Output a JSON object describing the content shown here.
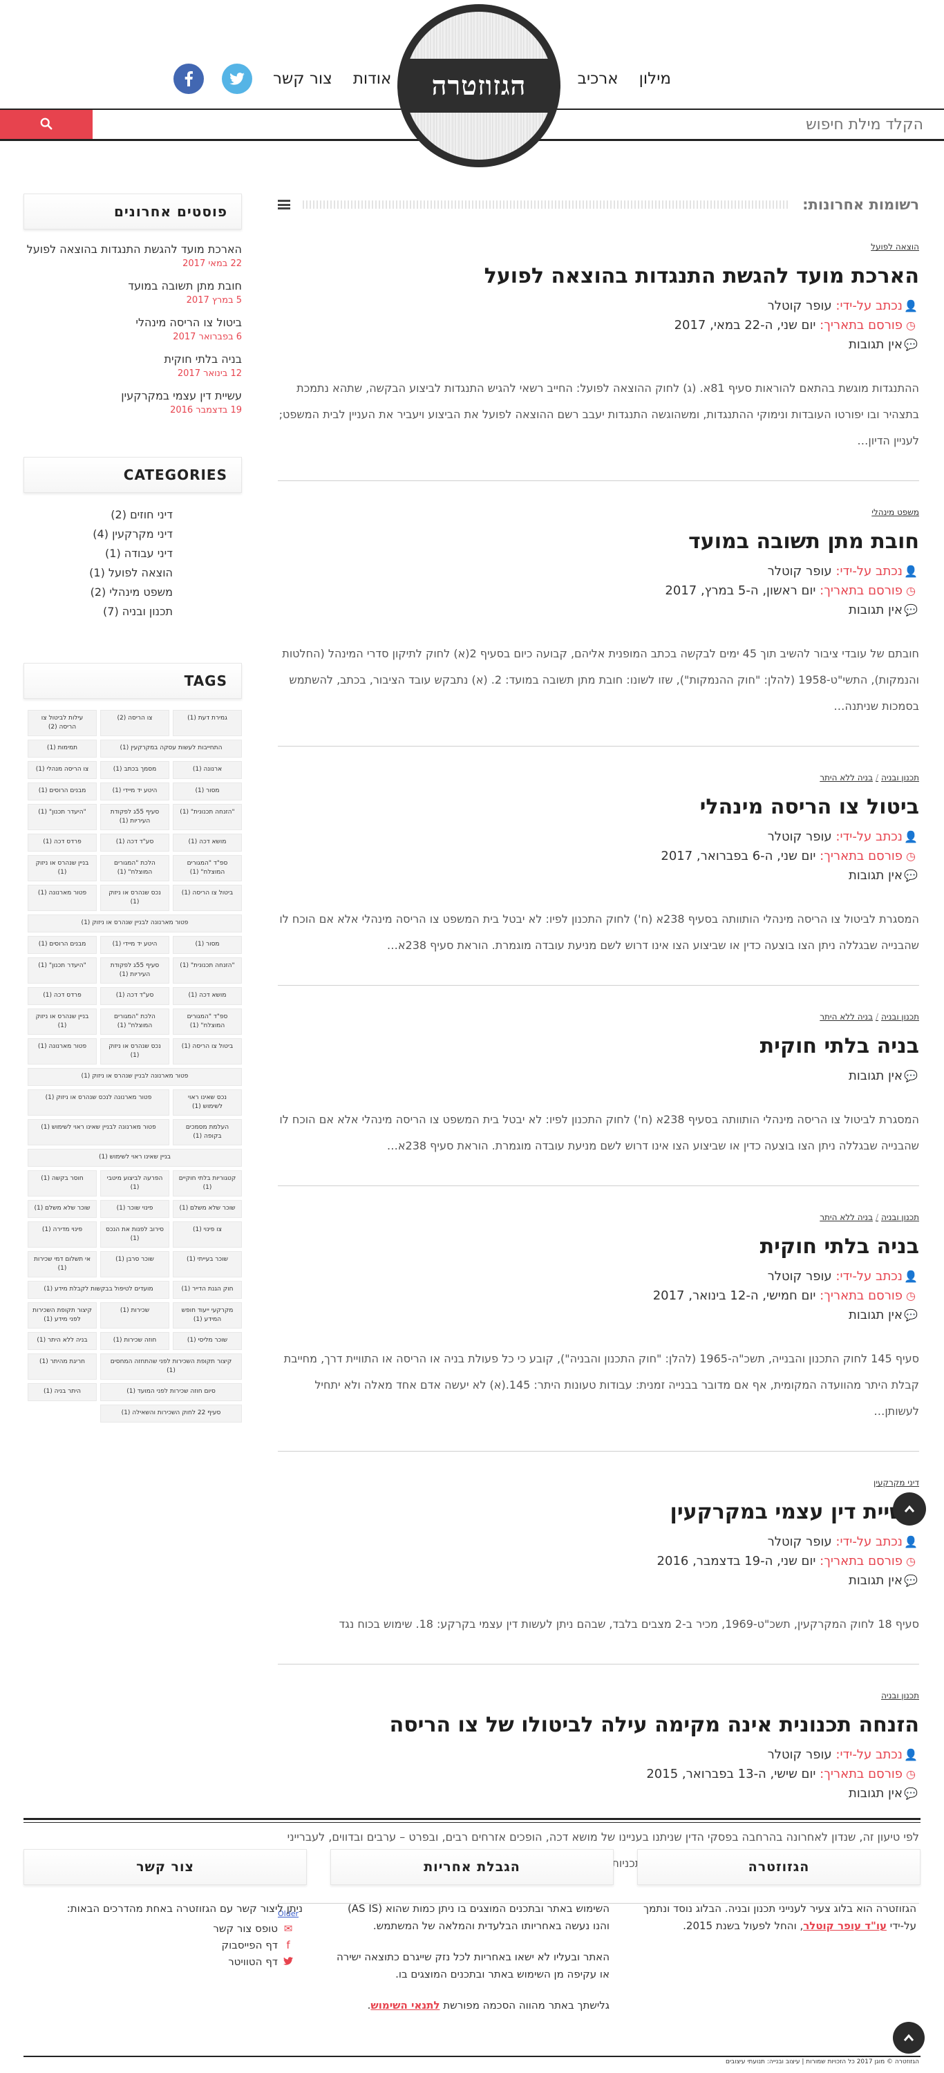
{
  "header": {
    "nav_right": [
      "מילון",
      "ארכיב"
    ],
    "nav_left": [
      "אודות",
      "צור קשר"
    ],
    "logo_text": "הגזוזטרה",
    "search_placeholder": "הקלד מילת חיפוש",
    "social": {
      "twitter": "twitter-icon",
      "facebook": "facebook-icon"
    }
  },
  "main": {
    "heading": "רשומות אחרונות:",
    "meta_labels": {
      "author": "נכתב על-ידי:",
      "date": "פורסם בתאריך:"
    },
    "posts": [
      {
        "cats": [
          "הוצאה לפועל"
        ],
        "title": "הארכת מועד להגשת התנגדות בהוצאה לפועל",
        "author": "עופר קוטלר",
        "date": "יום שני, ה-22 במאי, 2017",
        "comments": "אין תגובות",
        "excerpt": "ההתנגדות מוגשת בהתאם להוראות סעיף 81א. (ג) לחוק ההוצאה לפועל: החייב רשאי להגיש התנגדות לביצוע הבקשה, שתהא נתמכת בתצהיר ובו יפורטו העובדות ונימוקי ההתנגדות, ומשהוגשה התנגדות יעבב רשם ההוצאה לפועל את הביצוע ויעביר את העניין לבית המשפט; לעניין הדיון…"
      },
      {
        "cats": [
          "משפט מינהלי"
        ],
        "title": "חובת מתן תשובה במועד",
        "author": "עופר קוטלר",
        "date": "יום ראשון, ה-5 במרץ, 2017",
        "comments": "אין תגובות",
        "excerpt": "חובתם של עובדי ציבור להשיב תוך 45 ימים לבקשה בכתב המופנית אליהם, קבועה כיום בסעיף 2(א) לחוק לתיקון סדרי המינהל (החלטות והנמקות), התשי\"ט-1958 (להלן: \"חוק ההנמקות\"), שזו לשונו: חובת מתן תשובה במועד: 2. (א) נתבקש עובד הציבור, בכתב, להשתמש בסמכות שניתנה…"
      },
      {
        "cats": [
          "תכנון ובניה",
          "בניה ללא היתר"
        ],
        "title": "ביטול צו הריסה מינהלי",
        "author": "עופר קוטלר",
        "date": "יום שני, ה-6 בפברואר, 2017",
        "comments": "אין תגובות",
        "excerpt": "המסגרת לביטול צו הריסה מינהלי הותוותה בסעיף 238א (ח') לחוק התכנון לפיו: לא יבטל בית המשפט צו הריסה מינהלי אלא אם הוכח לו שהבנייה שבגללה ניתן הצו בוצעה כדין או שביצוע הצו אינו דרוש לשם מניעת עובדה מוגמרת. הוראת סעיף 238א…"
      },
      {
        "cats": [
          "תכנון ובניה",
          "בניה ללא היתר"
        ],
        "title": "בניה בלתי חוקית",
        "comments": "אין תגובות",
        "excerpt": "המסגרת לביטול צו הריסה מינהלי הותוותה בסעיף 238א (ח') לחוק התכנון לפיו: לא יבטל בית המשפט צו הריסה מינהלי אלא אם הוכח לו שהבנייה שבגללה ניתן הצו בוצעה כדין או שביצוע הצו אינו דרוש לשם מניעת עובדה מוגמרת. הוראת סעיף 238א…"
      },
      {
        "cats": [
          "תכנון ובניה",
          "בניה ללא היתר"
        ],
        "title": "בניה בלתי חוקית",
        "author": "עופר קוטלר",
        "date": "יום חמישי, ה-12 בינואר, 2017",
        "comments": "אין תגובות",
        "excerpt": "סעיף 145 לחוק התכנון והבנייה, תשכ\"ה-1965 (להלן: \"חוק התכנון והבניה\"), קובע כי כל פעולת בניה או הריסה או התוויית דרך, מחייבת קבלת היתר מהוועדה המקומית, אף אם מדובר בבנייה זמנית: עבודות טעונות היתר: 145.(א) לא יעשה אדם אחד מאלה ולא יתחיל לעשותן…"
      },
      {
        "cats": [
          "דיני מקרקעין"
        ],
        "title": "עשיית דין עצמי במקרקעין",
        "author": "עופר קוטלר",
        "date": "יום שני, ה-19 בדצמבר, 2016",
        "comments": "אין תגובות",
        "excerpt": "סעיף 18 לחוק המקרקעין, תשכ\"ט-1969, מכיר ב-2 מצבים בלבד, שבהם ניתן לעשות דין עצמי בקרקע: 18. שימוש בכוח נגד"
      },
      {
        "cats": [
          "תכנון ובניה"
        ],
        "title": "הזנחה תכנונית אינה מקימה עילה לביטולו של צו הריסה",
        "author": "עופר קוטלר",
        "date": "יום שישי, ה-13 בפברואר, 2015",
        "comments": "אין תגובות",
        "excerpt": "לפי טיעון זה, שנדון לאחרונה בהרחבה בפסקי הדין שניתנו בעניינו של מושא דכה, הופכים אזרחים רבים, ובפרט – ערבים ובדווים, לעברייני בנייה בעל כורחם – וזאת בשל היעדר תכניות מתאר או בשל תכניות מתאר מיושנות, שאינן…"
      }
    ],
    "older_link": "Older"
  },
  "sidebar": {
    "recent_title": "פוסטים אחרונים",
    "recent": [
      {
        "title": "הארכת מועד להגשת התנגדות בהוצאה לפועל",
        "date": "22 במאי 2017"
      },
      {
        "title": "חובת מתן תשובה במועד",
        "date": "5 במרץ 2017"
      },
      {
        "title": "ביטול צו הריסה מינהלי",
        "date": "6 בפברואר 2017"
      },
      {
        "title": "בניה בלתי חוקית",
        "date": "12 בינואר 2017"
      },
      {
        "title": "עשיית דין עצמי במקרקעין",
        "date": "19 בדצמבר 2016"
      }
    ],
    "categories_title": "CATEGORIES",
    "categories": [
      "דיני חוזים (2)",
      "דיני מקרקעין (4)",
      "דיני עבודה (1)",
      "הוצאה לפועל (1)",
      "משפט מינהלי (2)",
      "תכנון ובניה (7)"
    ],
    "tags_title": "TAGS",
    "tags": [
      {
        "t": "גמירת דעת (1)",
        "w": 1
      },
      {
        "t": "צו הריסה (2)",
        "w": 1
      },
      {
        "t": "עילות לביטול צו הריסה (2)",
        "w": 1
      },
      {
        "t": "התחייבות לעשות עסקה במקרקעין (1)",
        "w": 2
      },
      {
        "t": "תמימות (1)",
        "w": 1
      },
      {
        "t": "ארנונה (1)",
        "w": 1
      },
      {
        "t": "מסמך בכתב (1)",
        "w": 1
      },
      {
        "t": "צו הריסה מנהלי (1)",
        "w": 1
      },
      {
        "t": "מסור (1)",
        "w": 1
      },
      {
        "t": "היטע יד מיידי (1)",
        "w": 1
      },
      {
        "t": "מבנים הרוסים (1)",
        "w": 1
      },
      {
        "t": "\"הזנחה תכנונית\" (1)",
        "w": 1
      },
      {
        "t": "סעיף 55ג לפקודת העיריות (1)",
        "w": 1
      },
      {
        "t": "\"היעדר תכנון\" (1)",
        "w": 1
      },
      {
        "t": "מושא דכה (1)",
        "w": 1
      },
      {
        "t": "סע\"ד דכה (1)",
        "w": 1
      },
      {
        "t": "פרדס דכה (1)",
        "w": 1
      },
      {
        "t": "ספ\"ד \"המגורים המוצלח\" (1)",
        "w": 1
      },
      {
        "t": "הלכת \"המגורים המוצלח\" (1)",
        "w": 1
      },
      {
        "t": "בניין שנהרס או ניזוק (1)",
        "w": 1
      },
      {
        "t": "ביטול צו הריסה (1)",
        "w": 1
      },
      {
        "t": "נכס שנהרס או ניזוק (1)",
        "w": 1
      },
      {
        "t": "פטור מארנונה (1)",
        "w": 1
      },
      {
        "t": "פטור מארנונה לבניין שנהרס או ניזוק (1)",
        "w": 3
      },
      {
        "t": "מסור (1)",
        "w": 1
      },
      {
        "t": "היטע יד מיידי (1)",
        "w": 1
      },
      {
        "t": "מבנים הרוסים (1)",
        "w": 1
      },
      {
        "t": "\"הזנחה תכנונית\" (1)",
        "w": 1
      },
      {
        "t": "סעיף 55ג לפקודת העיריות (1)",
        "w": 1
      },
      {
        "t": "\"היעדר תכנון\" (1)",
        "w": 1
      },
      {
        "t": "מושא דכה (1)",
        "w": 1
      },
      {
        "t": "סע\"ד דכה (1)",
        "w": 1
      },
      {
        "t": "פרדס דכה (1)",
        "w": 1
      },
      {
        "t": "ספ\"ד \"המגורים המוצלח\" (1)",
        "w": 1
      },
      {
        "t": "הלכת \"המגורים המוצלח\" (1)",
        "w": 1
      },
      {
        "t": "בניין שנהרס או ניזוק (1)",
        "w": 1
      },
      {
        "t": "ביטול צו הריסה (1)",
        "w": 1
      },
      {
        "t": "נכס שנהרס או ניזוק (1)",
        "w": 1
      },
      {
        "t": "פטור מארנונה (1)",
        "w": 1
      },
      {
        "t": "פטור מארנונה לבניין שנהרס או ניזוק (1)",
        "w": 3
      },
      {
        "t": "נכס שאינו ראוי לשימוש (1)",
        "w": 1
      },
      {
        "t": "פטור מארנונה לנכס שנהרס או ניזוק (1)",
        "w": 2
      },
      {
        "t": "העלמת מסמכים בקופה (1)",
        "w": 1
      },
      {
        "t": "פטור מארנונה לבניין שאינו ראוי לשימוש (1)",
        "w": 2
      },
      {
        "t": "בניין שאינו ראוי לשימוש (1)",
        "w": 3
      },
      {
        "t": "קטגוריות בלתי חוקיים (1)",
        "w": 1
      },
      {
        "t": "הפרעה לביצוע מיטבי (1)",
        "w": 1
      },
      {
        "t": "חוסר בקשה (1)",
        "w": 1
      },
      {
        "t": "שוכר שלא משלם (1)",
        "w": 1
      },
      {
        "t": "פינוי שוכר (1)",
        "w": 1
      },
      {
        "t": "שוכר שלא משלם (1)",
        "w": 1
      },
      {
        "t": "צו פינוי (1)",
        "w": 1
      },
      {
        "t": "סירוב לפנות את הנכס (1)",
        "w": 1
      },
      {
        "t": "פינוי מדירה (1)",
        "w": 1
      },
      {
        "t": "שוכר בעייתי (1)",
        "w": 1
      },
      {
        "t": "שוכר סרבן (1)",
        "w": 1
      },
      {
        "t": "אי תשלום דמי שכירות (1)",
        "w": 1
      },
      {
        "t": "חוק הגנת הדייר (1)",
        "w": 1
      },
      {
        "t": "מועדים לטיפול בבקשות לקבלת מידע (1)",
        "w": 2
      },
      {
        "t": "מקרקעי ייעוד חופש המידע (1)",
        "w": 1
      },
      {
        "t": "שכירות (1)",
        "w": 1
      },
      {
        "t": "קיצור תקופת השכירות לפני מידע (1)",
        "w": 1
      },
      {
        "t": "שוכר מליסי (1)",
        "w": 1
      },
      {
        "t": "חוזה שכירות (1)",
        "w": 1
      },
      {
        "t": "בניה ללא היתר (1)",
        "w": 1
      },
      {
        "t": "קיצור תקופת השכירות לפני שהתחזה המחסים (1)",
        "w": 2
      },
      {
        "t": "חריגת מהיתר (1)",
        "w": 1
      },
      {
        "t": "סיום חוזה שכירות לפני המועד (1)",
        "w": 2
      },
      {
        "t": "היתר בניה (1)",
        "w": 1
      },
      {
        "t": "סעיף 22 לחוק השכירות והשאילה (1)",
        "w": 2
      }
    ]
  },
  "footer": {
    "col1": {
      "title": "הגזוזטרה",
      "text_a": "הגזוזטרה הוא בלוג צעיר לענייני תכנון ובניה. הבלוג נוסד ונתמך על-ידי",
      "link": "עו\"ד עופר קוטלר",
      "text_b": ", והחל לפעול בשנת 2015."
    },
    "col2": {
      "title": "הגבלת אחריות",
      "p1": "השימוש באתר ובתכנים המוצגים בו ניתן כמות שהוא (AS IS) והנו נעשה באחריותו הבלעדית והמלאה של המשתמש.",
      "p2": "האתר ובעליו לא ישאו באחריות לכל נזק שייגרם כתוצאה ישירה או עקיפה מן השימוש באתר ובתכנים המוצגים בו.",
      "p3_a": "גלישתך באתר מהווה הסכמה מפורשת",
      "p3_link": "לתנאי השימוש",
      "p3_b": "."
    },
    "col3": {
      "title": "צור קשר",
      "intro": "ניתן ליצור קשר עם הגזוזטרה באחת מהדרכים הבאות:",
      "items": [
        {
          "icon": "envelope-icon",
          "label": "טופס צור קשר"
        },
        {
          "icon": "facebook-icon",
          "label": "דף הפייסבוק"
        },
        {
          "icon": "twitter-icon",
          "label": "דף הטוויטר"
        }
      ]
    },
    "copyright": "הגזוזטרה © מוגן 2017 כל הזכויות שמורות | עיצוב ובנייה: תנועתי עיצובים"
  },
  "colors": {
    "accent": "#e7434e",
    "dark": "#2e2e2e",
    "twitter": "#55b4e6",
    "facebook": "#4267b2"
  }
}
